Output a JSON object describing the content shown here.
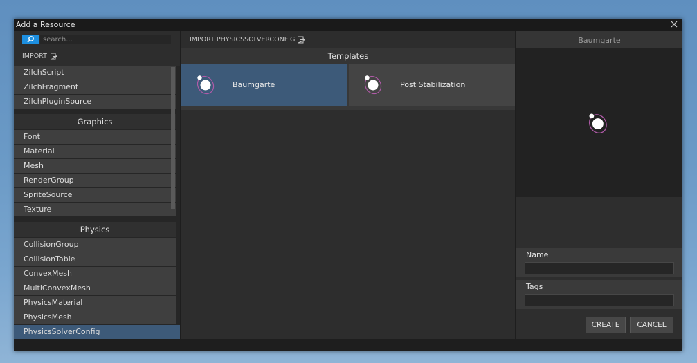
{
  "window": {
    "title": "Add a Resource"
  },
  "left": {
    "search_placeholder": "search...",
    "import_label": "IMPORT",
    "top_items": [
      "ZilchScript",
      "ZilchFragment",
      "ZilchPluginSource"
    ],
    "groups": [
      {
        "header": "Graphics",
        "items": [
          "Font",
          "Material",
          "Mesh",
          "RenderGroup",
          "SpriteSource",
          "Texture"
        ]
      },
      {
        "header": "Physics",
        "items": [
          "CollisionGroup",
          "CollisionTable",
          "ConvexMesh",
          "MultiConvexMesh",
          "PhysicsMaterial",
          "PhysicsMesh",
          "PhysicsSolverConfig"
        ]
      }
    ],
    "selected_item": "PhysicsSolverConfig"
  },
  "middle": {
    "import_label": "IMPORT PHYSICSSOLVERCONFIG",
    "templates_header": "Templates",
    "templates": [
      {
        "label": "Baumgarte",
        "selected": true
      },
      {
        "label": "Post Stabilization",
        "selected": false
      }
    ]
  },
  "right": {
    "preview_title": "Baumgarte",
    "name_label": "Name",
    "name_value": "",
    "tags_label": "Tags",
    "tags_value": "",
    "create_label": "CREATE",
    "cancel_label": "CANCEL"
  },
  "colors": {
    "accent": "#1d8fe0",
    "selection": "#3d5a79",
    "orbit": "#b05aa8"
  }
}
